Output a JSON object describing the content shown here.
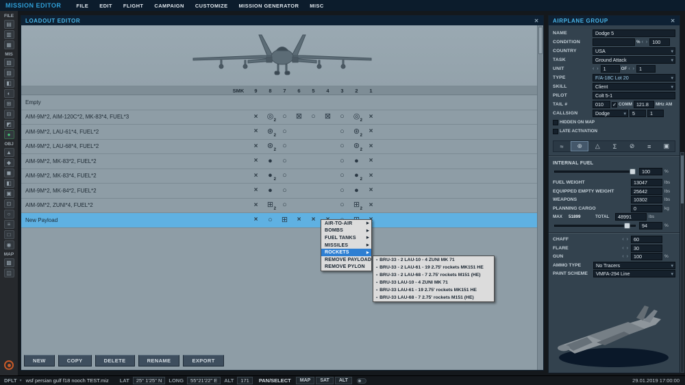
{
  "icons": {
    "close": "✕",
    "check": "✓",
    "dropdown": "▾",
    "arrow_right": "▶",
    "bullet": "▪",
    "spin": "‹ ›"
  },
  "weapon_glyphs": {
    "x": "×",
    "ring": "○",
    "fuel": "◎",
    "bomb": "●",
    "clus": "⊛",
    "zuni": "⊞",
    "wide": "⊠"
  },
  "top_bar": {
    "title": "MISSION EDITOR",
    "menus": [
      "FILE",
      "EDIT",
      "FLIGHT",
      "CAMPAIGN",
      "CUSTOMIZE",
      "MISSION GENERATOR",
      "MISC"
    ]
  },
  "sidebar": {
    "sections": [
      {
        "label": "FILE",
        "icons": [
          {
            "n": "new-mission-icon",
            "g": "▤"
          },
          {
            "n": "open-mission-icon",
            "g": "▥"
          },
          {
            "n": "save-mission-icon",
            "g": "▦"
          }
        ]
      },
      {
        "label": "MIS",
        "icons": [
          {
            "n": "briefing-icon",
            "g": "▧"
          },
          {
            "n": "conditions-icon",
            "g": "▨"
          },
          {
            "n": "weather-icon",
            "g": "◧"
          },
          {
            "n": "time-icon",
            "g": "◐"
          },
          {
            "n": "options-icon",
            "g": "⊞"
          },
          {
            "n": "rules-icon",
            "g": "⊟"
          },
          {
            "n": "triggers-icon",
            "g": "◩"
          },
          {
            "n": "status-green-icon",
            "g": "●",
            "green": true
          }
        ]
      },
      {
        "label": "OBJ",
        "icons": [
          {
            "n": "airplane-icon",
            "g": "▲"
          },
          {
            "n": "helicopter-icon",
            "g": "◆"
          },
          {
            "n": "ship-icon",
            "g": "◼"
          },
          {
            "n": "vehicle-icon",
            "g": "◧"
          },
          {
            "n": "static-object-icon",
            "g": "▣"
          },
          {
            "n": "template-icon",
            "g": "⊡"
          },
          {
            "n": "zone-icon",
            "g": "○"
          },
          {
            "n": "distance-icon",
            "g": "≡"
          },
          {
            "n": "label-icon",
            "g": "□"
          },
          {
            "n": "marker-icon",
            "g": "◉"
          }
        ]
      },
      {
        "label": "MAP",
        "icons": [
          {
            "n": "layers-icon",
            "g": "▩"
          },
          {
            "n": "map-options-icon",
            "g": "◫"
          }
        ]
      }
    ]
  },
  "loadout": {
    "title": "LOADOUT EDITOR",
    "columns": [
      "SMK",
      "9",
      "8",
      "7",
      "6",
      "5",
      "4",
      "3",
      "2",
      "1"
    ],
    "rows": [
      {
        "name": "Empty",
        "cells": [
          "",
          "",
          "",
          "",
          "",
          "",
          "",
          "",
          "",
          ""
        ]
      },
      {
        "name": "AIM-9M*2, AIM-120C*2, MK-83*4, FUEL*3",
        "cells": [
          "",
          "x",
          "fuel+2",
          "ring",
          "wide",
          "ring",
          "wide",
          "ring",
          "fuel+2",
          "x"
        ]
      },
      {
        "name": "AIM-9M*2, LAU-61*4, FUEL*2",
        "cells": [
          "",
          "x",
          "clus+2",
          "ring",
          "",
          "",
          "",
          "ring",
          "clus+2",
          "x"
        ]
      },
      {
        "name": "AIM-9M*2, LAU-68*4, FUEL*2",
        "cells": [
          "",
          "x",
          "clus+2",
          "ring",
          "",
          "",
          "",
          "ring",
          "clus+2",
          "x"
        ]
      },
      {
        "name": "AIM-9M*2, MK-83*2, FUEL*2",
        "cells": [
          "",
          "x",
          "bomb",
          "ring",
          "",
          "",
          "",
          "ring",
          "bomb",
          "x"
        ]
      },
      {
        "name": "AIM-9M*2, MK-83*4, FUEL*2",
        "cells": [
          "",
          "x",
          "bomb+2",
          "ring",
          "",
          "",
          "",
          "ring",
          "bomb+2",
          "x"
        ]
      },
      {
        "name": "AIM-9M*2, MK-84*2, FUEL*2",
        "cells": [
          "",
          "x",
          "bomb",
          "ring",
          "",
          "",
          "",
          "ring",
          "bomb",
          "x"
        ]
      },
      {
        "name": "AIM-9M*2, ZUNI*4, FUEL*2",
        "cells": [
          "",
          "x",
          "zuni+2",
          "ring",
          "",
          "",
          "",
          "ring",
          "zuni+2",
          "x"
        ]
      },
      {
        "name": "New Payload",
        "selected": true,
        "cells": [
          "",
          "x",
          "ring",
          "zuni",
          "x",
          "x",
          "x",
          "ring",
          "zuni",
          "x"
        ]
      }
    ],
    "buttons": [
      "NEW",
      "COPY",
      "DELETE",
      "RENAME",
      "EXPORT"
    ]
  },
  "context_menu": {
    "items": [
      {
        "label": "AIR-TO-AIR",
        "arrow": true
      },
      {
        "label": "BOMBS",
        "arrow": true
      },
      {
        "label": "FUEL TANKS",
        "arrow": true
      },
      {
        "label": "MISSILES",
        "arrow": true
      },
      {
        "label": "ROCKETS",
        "arrow": true,
        "highlighted": true
      },
      {
        "label": "REMOVE PAYLOAD",
        "arrow": false
      },
      {
        "label": "REMOVE PYLON",
        "arrow": false
      }
    ],
    "submenu_items": [
      "BRU-33 - 2 LAU-10 - 4 ZUNI MK 71",
      "BRU-33 - 2 LAU-61 - 19 2.75' rockets MK151 HE",
      "BRU-33 - 2 LAU-68 - 7 2.75' rockets M151 (HE)",
      "BRU-33 LAU-10 - 4 ZUNI MK 71",
      "BRU-33 LAU-61 - 19 2.75' rockets MK151 HE",
      "BRU-33 LAU-68 - 7 2.75' rockets M151 (HE)"
    ]
  },
  "airplane": {
    "title": "AIRPLANE GROUP",
    "name_label": "NAME",
    "name_value": "Dodge 5",
    "condition_label": "CONDITION",
    "condition_value": "",
    "condition_pct": "%",
    "condition_num": "100",
    "country_label": "COUNTRY",
    "country_value": "USA",
    "task_label": "TASK",
    "task_value": "Ground Attack",
    "unit_label": "UNIT",
    "unit_value": "1",
    "unit_of": "OF",
    "unit_total": "1",
    "type_label": "TYPE",
    "type_value": "F/A-18C Lot 20",
    "skill_label": "SKILL",
    "skill_value": "Client",
    "pilot_label": "PILOT",
    "pilot_value": "Colt 5-1",
    "tail_label": "TAIL #",
    "tail_value": "010",
    "comm_label": "COMM",
    "comm_freq": "121.8",
    "comm_unit": "MHz AM",
    "callsign_label": "CALLSIGN",
    "callsign_value": "Dodge",
    "callsign_num1": "5",
    "callsign_num2": "1",
    "hidden_label": "HIDDEN ON MAP",
    "late_label": "LATE ACTIVATION"
  },
  "tabs": {
    "active_index": 1,
    "items": [
      {
        "n": "tab-route",
        "g": "≈"
      },
      {
        "n": "tab-loadout",
        "g": "⊕"
      },
      {
        "n": "tab-advanced",
        "g": "△"
      },
      {
        "n": "tab-summary",
        "g": "Σ"
      },
      {
        "n": "tab-failures",
        "g": "⊘"
      },
      {
        "n": "tab-radio",
        "g": "≡"
      },
      {
        "n": "tab-cargo",
        "g": "▣"
      }
    ]
  },
  "fuel": {
    "internal_label": "INTERNAL FUEL",
    "internal_value": "100",
    "internal_unit": "%",
    "rows": [
      {
        "label": "FUEL WEIGHT",
        "value": "13047",
        "unit": "lbs"
      },
      {
        "label": "EQUIPPED EMPTY WEIGHT",
        "value": "25642",
        "unit": "lbs"
      },
      {
        "label": "WEAPONS",
        "value": "10302",
        "unit": "lbs"
      },
      {
        "label": "PLANNING CARGO",
        "value": "0",
        "unit": "kg"
      }
    ],
    "max_label": "MAX",
    "max_value": "51899",
    "total_label": "TOTAL",
    "total_value": "48991",
    "total_unit": "lbs",
    "total_pct": "94",
    "total_pct_unit": "%",
    "chaff_label": "CHAFF",
    "chaff_value": "60",
    "flare_label": "FLARE",
    "flare_value": "30",
    "gun_label": "GUN",
    "gun_value": "100",
    "gun_unit": "%",
    "ammo_label": "AMMO TYPE",
    "ammo_value": "No Tracers",
    "paint_label": "PAINT SCHEME",
    "paint_value": "VMFA-294 Line"
  },
  "status_bar": {
    "mode": "DFLT",
    "filename": "wsf persian gulf f18 nooch TEST.miz",
    "lat_label": "LAT",
    "lat_value": "25° 1'25\" N",
    "long_label": "LONG",
    "long_value": "55°21'22\" E",
    "alt_label": "ALT",
    "alt_value": "171",
    "pan_label": "PAN/SELECT",
    "buttons": [
      "MAP",
      "SAT",
      "ALT"
    ],
    "datetime": "29.01.2019 17:00:00"
  }
}
